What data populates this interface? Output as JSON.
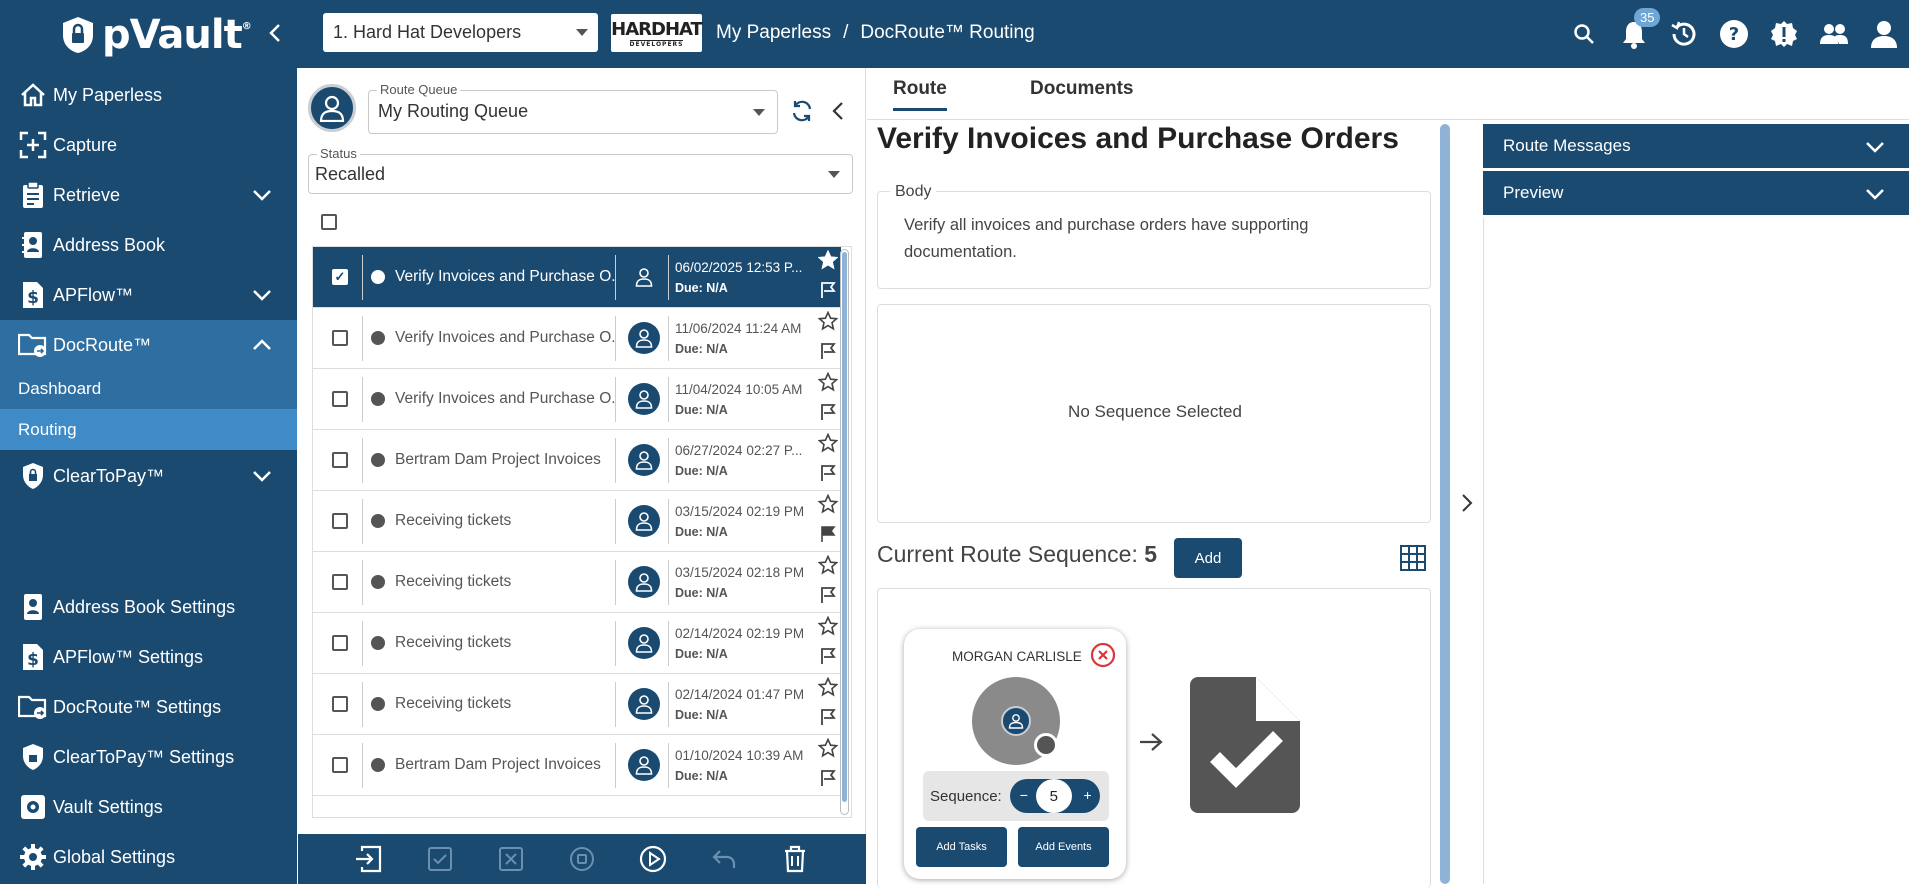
{
  "app": {
    "name": "pVault"
  },
  "header": {
    "org_select": "1. Hard Hat Developers",
    "brand_logo_main": "HARDHAT",
    "brand_logo_sub": "DEVELOPERS",
    "breadcrumb_1": "My Paperless",
    "breadcrumb_sep": "/",
    "breadcrumb_2": "DocRoute™ Routing",
    "notifications_count": "35"
  },
  "sidebar": {
    "my_paperless": "My Paperless",
    "capture": "Capture",
    "retrieve": "Retrieve",
    "address_book": "Address Book",
    "apflow": "APFlow™",
    "docroute": "DocRoute™",
    "dashboard": "Dashboard",
    "routing": "Routing",
    "cleartopay": "ClearToPay™",
    "address_book_settings": "Address Book Settings",
    "apflow_settings": "APFlow™ Settings",
    "docroute_settings": "DocRoute™ Settings",
    "cleartopay_settings": "ClearToPay™ Settings",
    "vault_settings": "Vault Settings",
    "global_settings": "Global Settings"
  },
  "queue": {
    "route_queue_label": "Route Queue",
    "route_queue_value": "My Routing Queue",
    "status_label": "Status",
    "status_value": "Recalled"
  },
  "rows": [
    {
      "title": "Verify Invoices and Purchase O...",
      "date": "06/02/2025 12:53 P...",
      "due": "Due: N/A"
    },
    {
      "title": "Verify Invoices and Purchase O...",
      "date": "11/06/2024 11:24 AM",
      "due": "Due: N/A"
    },
    {
      "title": "Verify Invoices and Purchase O...",
      "date": "11/04/2024 10:05 AM",
      "due": "Due: N/A"
    },
    {
      "title": "Bertram Dam Project Invoices",
      "date": "06/27/2024 02:27 P...",
      "due": "Due: N/A"
    },
    {
      "title": "Receiving tickets",
      "date": "03/15/2024 02:19 PM",
      "due": "Due: N/A"
    },
    {
      "title": "Receiving tickets",
      "date": "03/15/2024 02:18 PM",
      "due": "Due: N/A"
    },
    {
      "title": "Receiving tickets",
      "date": "02/14/2024 02:19 PM",
      "due": "Due: N/A"
    },
    {
      "title": "Receiving tickets",
      "date": "02/14/2024 01:47 PM",
      "due": "Due: N/A"
    },
    {
      "title": "Bertram Dam Project Invoices",
      "date": "01/10/2024 10:39 AM",
      "due": "Due: N/A"
    }
  ],
  "tabs": {
    "route": "Route",
    "documents": "Documents"
  },
  "route": {
    "title": "Verify Invoices and Purchase Orders",
    "body_label": "Body",
    "body_text": "Verify all invoices and purchase orders have supporting documentation.",
    "no_sequence": "No Sequence Selected",
    "current_seq_label": "Current Route Sequence:",
    "current_seq_value": "5",
    "add_label": "Add",
    "card": {
      "name": "MORGAN CARLISLE",
      "sequence_label": "Sequence:",
      "sequence_value": "5",
      "minus": "−",
      "plus": "+",
      "add_tasks": "Add Tasks",
      "add_events": "Add Events"
    }
  },
  "panels": {
    "route_messages": "Route Messages",
    "preview": "Preview"
  },
  "colors": {
    "primary": "#1b4a70",
    "active": "#2e6ea1",
    "selected": "#3f8bc7",
    "danger": "#d9363e"
  }
}
